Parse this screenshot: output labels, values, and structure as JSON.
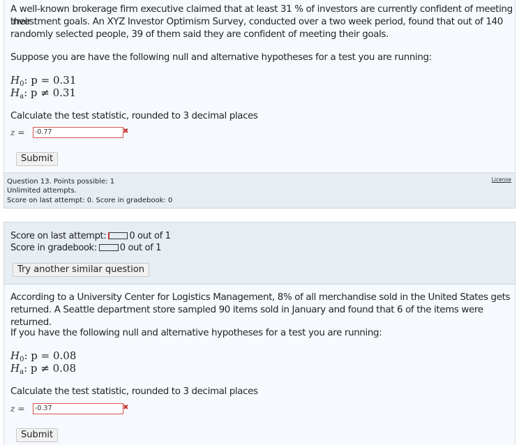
{
  "question1": {
    "prompt_lines": [
      "A well-known brokerage firm executive claimed that at least 31 % of investors are currently confident of meeting their",
      "investment goals. An XYZ Investor Optimism Survey, conducted over a two week period, found that out of 140",
      "randomly selected people, 39 of them said they are confident of meeting their goals."
    ],
    "hypotheses_intro": "Suppose you are have the following null and alternative hypotheses for a test you are running:",
    "h0": {
      "label": "H",
      "sub": "0",
      "rhs": ": p = 0.31"
    },
    "ha": {
      "label": "H",
      "sub": "a",
      "rhs": ": p ≠ 0.31"
    },
    "instruction": "Calculate the test statistic, rounded to 3 decimal places",
    "z_label": "z",
    "z_eq": "=",
    "answer_value": "-0.77",
    "incorrect_mark": "✖",
    "submit_label": "Submit"
  },
  "question_info": {
    "line1": "Question 13. Points possible: 1",
    "line2": "Unlimited attempts.",
    "line3": "Score on last attempt: 0. Score in gradebook: 0",
    "license_label": "License"
  },
  "score_panel": {
    "last_attempt_label": "Score on last attempt:",
    "last_attempt_value": "0 out of 1",
    "gradebook_label": "Score in gradebook:",
    "gradebook_value": "0 out of 1",
    "try_another_label": "Try another similar question"
  },
  "question2": {
    "prompt_lines": [
      "According to a University Center for Logistics Management, 8% of all merchandise sold in the United States gets",
      "returned. A Seattle department store sampled 90 items sold in January and found that 6 of the items were returned."
    ],
    "hypotheses_intro": "If you have the following null and alternative hypotheses for a test you are running:",
    "h0": {
      "label": "H",
      "sub": "0",
      "rhs": ": p = 0.08"
    },
    "ha": {
      "label": "H",
      "sub": "a",
      "rhs": ": p ≠ 0.08"
    },
    "instruction": "Calculate the test statistic, rounded to 3 decimal places",
    "z_label": "z",
    "z_eq": "=",
    "answer_value": "-0.37",
    "incorrect_mark": "✖",
    "submit_label": "Submit"
  }
}
